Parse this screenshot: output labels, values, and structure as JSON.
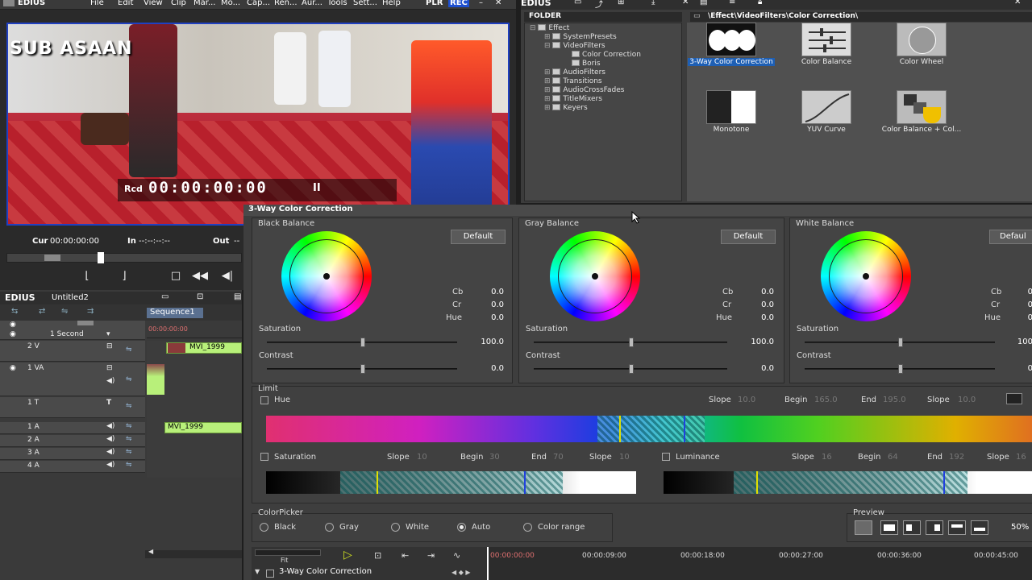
{
  "player": {
    "menu": {
      "app": "EDIUS",
      "items": [
        "File",
        "Edit",
        "View",
        "Clip",
        "Mar...",
        "Mo...",
        "Cap...",
        "Ren...",
        "Aur...",
        "Tools",
        "Sett...",
        "Help"
      ],
      "plr": "PLR",
      "rec": "REC"
    },
    "watermark": "SUB ASAAN",
    "rcd_label": "Rcd",
    "timecode": "00:00:00:00",
    "pause_glyph": "II",
    "cur_label": "Cur",
    "cur_value": "00:00:00:00",
    "in_label": "In",
    "in_value": "--:--:--:--",
    "out_label": "Out",
    "out_value": "--"
  },
  "effect_panel": {
    "app": "EDIUS",
    "folder_header": "FOLDER",
    "path": "\\Effect\\VideoFilters\\Color Correction\\",
    "tree": [
      "Effect",
      "SystemPresets",
      "VideoFilters",
      "Color Correction",
      "Boris",
      "AudioFilters",
      "Transitions",
      "AudioCrossFades",
      "TitleMixers",
      "Keyers"
    ],
    "effects": [
      "3-Way Color Correction",
      "Color Balance",
      "Color Wheel",
      "Monotone",
      "YUV Curve",
      "Color Balance + Col..."
    ]
  },
  "timeline": {
    "app": "EDIUS",
    "project": "Untitled2",
    "sequence": "Sequence1",
    "scale": "1 Second",
    "ruler_start": "00:00:00:00",
    "tracks": [
      "2 V",
      "1 VA",
      "1 T",
      "1 A",
      "2 A",
      "3 A",
      "4 A"
    ],
    "clips": [
      "MVI_1999",
      "MVI_1999"
    ]
  },
  "dialog": {
    "title": "3-Way Color Correction",
    "groups": [
      {
        "name": "Black Balance",
        "default": "Default",
        "cb": "0.0",
        "cr": "0.0",
        "hue": "0.0",
        "saturation": "100.0",
        "contrast": "0.0"
      },
      {
        "name": "Gray Balance",
        "default": "Default",
        "cb": "0.0",
        "cr": "0.0",
        "hue": "0.0",
        "saturation": "100.0",
        "contrast": "0.0"
      },
      {
        "name": "White Balance",
        "default": "Defaul",
        "cb": "0",
        "cr": "0",
        "hue": "0",
        "saturation": "100",
        "contrast": "0"
      }
    ],
    "labels": {
      "cb": "Cb",
      "cr": "Cr",
      "hue": "Hue",
      "saturation": "Saturation",
      "contrast": "Contrast"
    },
    "limit": {
      "title": "Limit",
      "hue_label": "Hue",
      "hue": {
        "slope1_label": "Slope",
        "slope1": "10.0",
        "begin_label": "Begin",
        "begin": "165.0",
        "end_label": "End",
        "end": "195.0",
        "slope2_label": "Slope",
        "slope2": "10.0"
      },
      "sat_label": "Saturation",
      "sat": {
        "slope1_label": "Slope",
        "slope1": "10",
        "begin_label": "Begin",
        "begin": "30",
        "end_label": "End",
        "end": "70",
        "slope2_label": "Slope",
        "slope2": "10"
      },
      "lum_label": "Luminance",
      "lum": {
        "slope1_label": "Slope",
        "slope1": "16",
        "begin_label": "Begin",
        "begin": "64",
        "end_label": "End",
        "end": "192",
        "slope2_label": "Slope",
        "slope2": "16"
      }
    },
    "colorpicker": {
      "title": "ColorPicker",
      "options": [
        "Black",
        "Gray",
        "White",
        "Auto",
        "Color range"
      ],
      "selected": "Auto"
    },
    "preview": {
      "title": "Preview",
      "zoom": "50%"
    },
    "bottom": {
      "fit": "Fit",
      "layer": "3-Way Color Correction",
      "ruler": [
        "00:00:00:00",
        "00:00:09:00",
        "00:00:18:00",
        "00:00:27:00",
        "00:00:36:00",
        "00:00:45:00"
      ]
    }
  }
}
